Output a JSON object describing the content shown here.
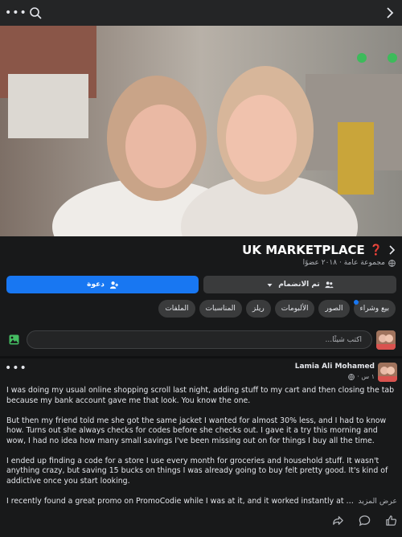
{
  "topbar": {
    "more_icon": "more-dots-icon",
    "search_icon": "search-icon",
    "back_icon": "chevron-right-icon"
  },
  "group": {
    "title": "UK MARKETPLACE",
    "title_badge": "❓",
    "meta": "مجموعة عامة · ٢٠١٨ عضوًا"
  },
  "buttons": {
    "invite": "دعوة",
    "joined": "تم الانضمام"
  },
  "tabs": [
    "بيع وشراء",
    "الصور",
    "الألبومات",
    "ريلز",
    "المناسبات",
    "الملفات"
  ],
  "composer": {
    "placeholder": "اكتب شيئًا..."
  },
  "post": {
    "author": "Lamia Ali Mohamed",
    "time": "١ س ·",
    "paragraphs": [
      "I was doing my usual online shopping scroll last night, adding stuff to my cart and then closing the tab because my bank account gave me that look. You know the one.",
      "But then my friend told me she got the same jacket I wanted for almost 30% less, and I had to know how. Turns out she always checks for codes before she checks out. I gave it a try this morning and wow, I had no idea how many small savings I've been missing out on for things I buy all the time.",
      "I ended up finding a code for a store I use every month for groceries and household stuff. It wasn't anything crazy, but saving 15 bucks on things I was already going to buy felt pretty good. It's kind of addictive once you start looking."
    ],
    "last_line": "I recently found a great promo on PromoCodie while I was at it, and it worked instantly at checko…",
    "see_more": "عرض المزيد"
  },
  "colors": {
    "accent": "#1877f2",
    "background": "#18191a",
    "surface": "#3a3b3c"
  }
}
